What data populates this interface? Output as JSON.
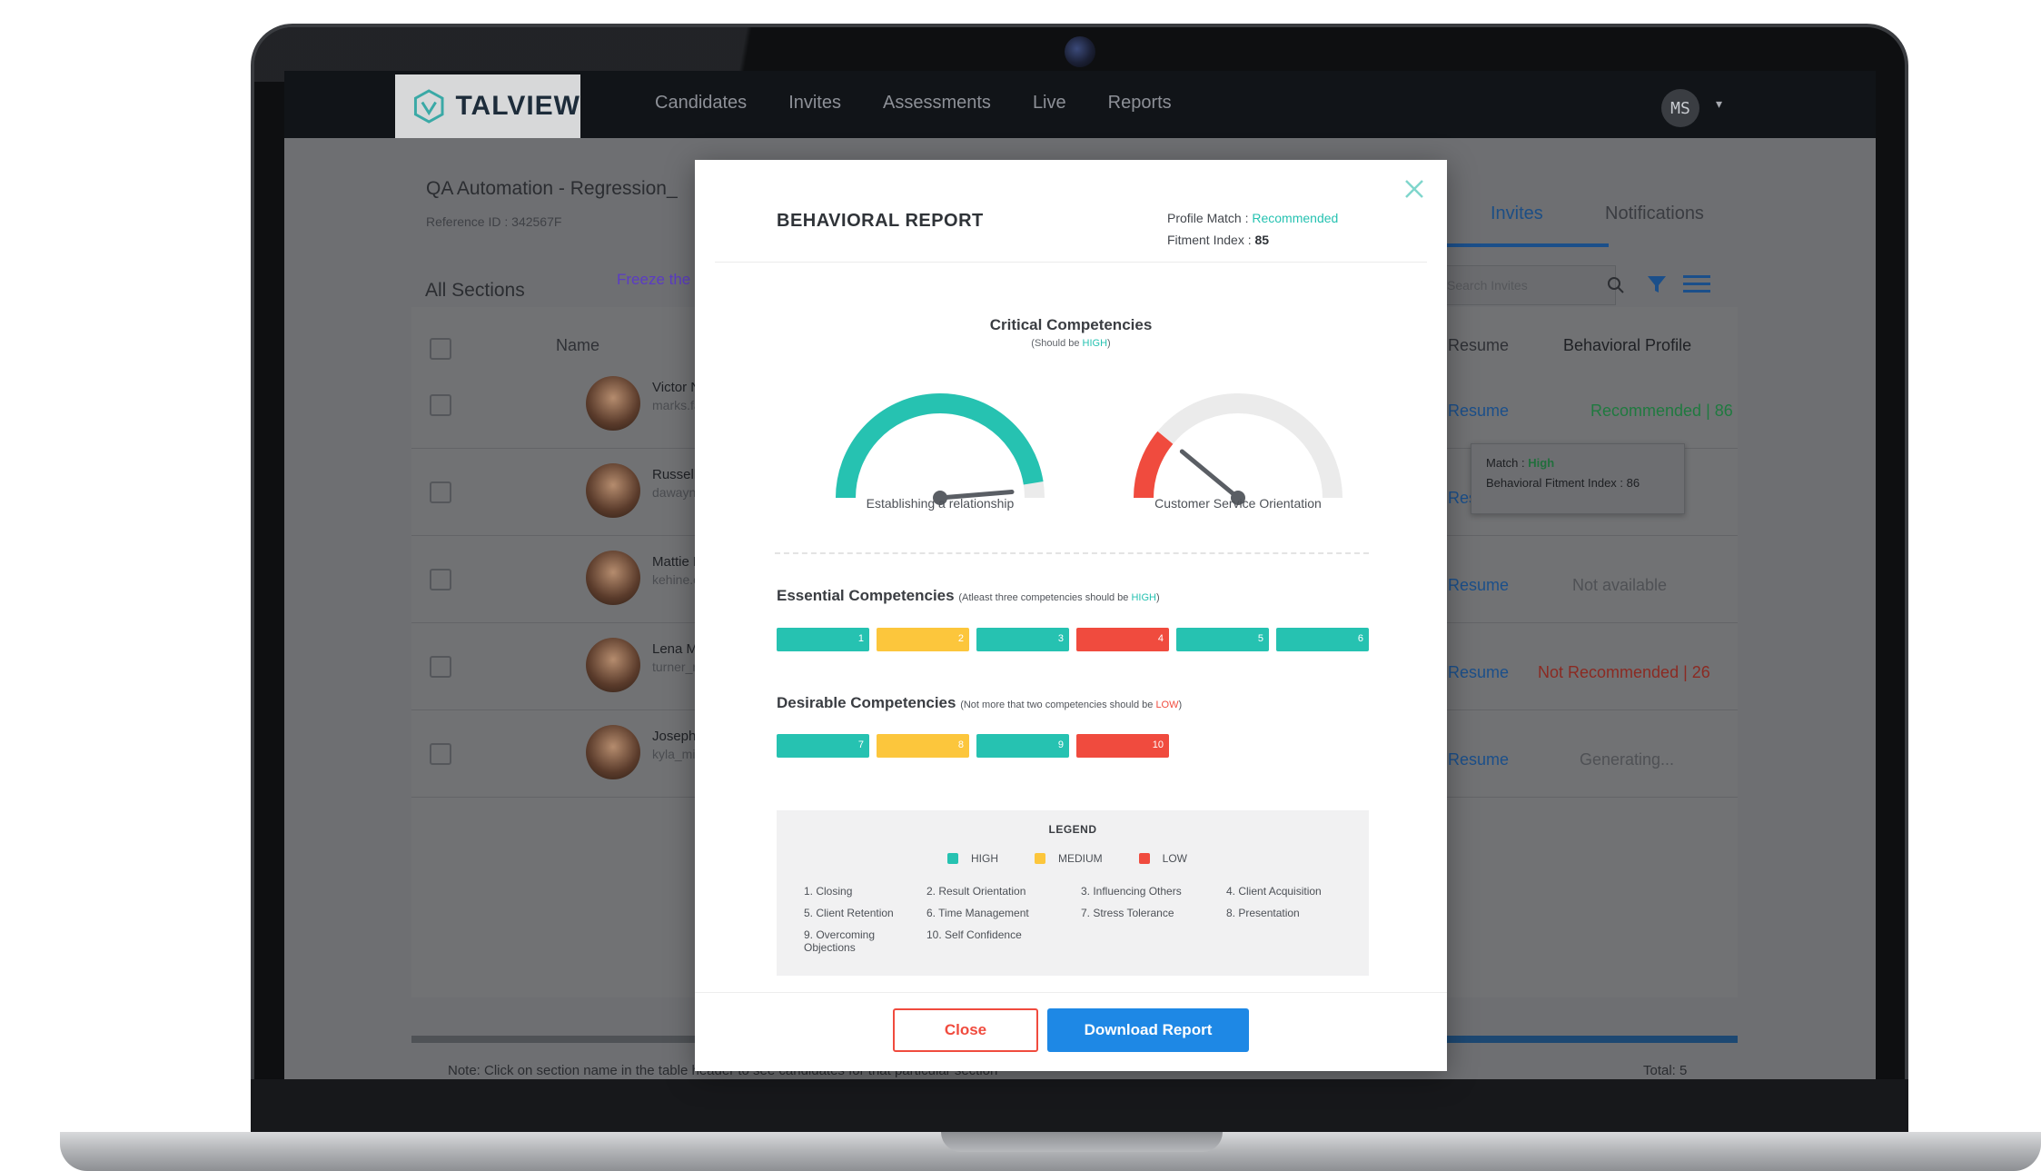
{
  "app": {
    "logo_text": "TALVIEW",
    "nav": [
      "Candidates",
      "Invites",
      "Assessments",
      "Live",
      "Reports"
    ],
    "user_initials": "MS",
    "caret": "▾"
  },
  "page": {
    "title": "QA Automation - Regression_",
    "reference": "Reference ID : 342567F",
    "all_sections": "All Sections",
    "freeze": "Freeze the",
    "tabs": [
      "Invites",
      "Notifications"
    ],
    "search_placeholder": "Search Invites",
    "columns": {
      "name": "Name",
      "resume": "Resume",
      "behavioral": "Behavioral Profile"
    },
    "rows": [
      {
        "name": "Victor Neal",
        "email": "marks.farna@davis.co",
        "resume": "Resume",
        "behavioral": "Recommended | 86"
      },
      {
        "name": "Russell Medina",
        "email": "dawayn_lorene@walt",
        "resume": "Resume",
        "behavioral": ""
      },
      {
        "name": "Mattie Porter",
        "email": "kehine.correll@hose",
        "resume": "Resume",
        "behavioral": "Not available"
      },
      {
        "name": "Lena Maxwell",
        "email": "turner_rollerick@gma",
        "resume": "Resume",
        "behavioral": "Not Recommended | 26"
      },
      {
        "name": "Joseph Hansen",
        "email": "kyla_mirrow@yahoo.c",
        "resume": "Resume",
        "behavioral": "Generating..."
      }
    ],
    "tooltip": {
      "match_label": "Match : ",
      "match_value": "High",
      "index": "Behavioral Fitment Index : 86"
    },
    "footer_note": "Note: Click on section name in the table header to see candidates for that particular section",
    "footer_total": "Total: 5"
  },
  "modal": {
    "title": "BEHAVIORAL REPORT",
    "profile_match_label": "Profile Match : ",
    "profile_match_value": "Recommended",
    "fitment_label": "Fitment Index : ",
    "fitment_value": "85",
    "critical": {
      "title": "Critical Competencies",
      "sub_prefix": "(Should be ",
      "sub_hl": "HIGH",
      "sub_suffix": ")",
      "gauges": [
        {
          "label": "Establishing a relationship",
          "level": 0.95,
          "color": "#26c2b1"
        },
        {
          "label": "Customer Service Orientation",
          "level": 0.22,
          "color": "#f04b3e"
        }
      ]
    },
    "essential": {
      "title": "Essential Competencies",
      "note_prefix": "(Atleast three competencies should be ",
      "note_hl": "HIGH",
      "note_suffix": ")",
      "bars": [
        {
          "n": "1",
          "level": "high"
        },
        {
          "n": "2",
          "level": "medium"
        },
        {
          "n": "3",
          "level": "high"
        },
        {
          "n": "4",
          "level": "low"
        },
        {
          "n": "5",
          "level": "high"
        },
        {
          "n": "6",
          "level": "high"
        }
      ]
    },
    "desirable": {
      "title": "Desirable Competencies",
      "note_prefix": "(Not more that two competencies should be ",
      "note_hl": "LOW",
      "note_suffix": ")",
      "bars": [
        {
          "n": "7",
          "level": "high"
        },
        {
          "n": "8",
          "level": "medium"
        },
        {
          "n": "9",
          "level": "high"
        },
        {
          "n": "10",
          "level": "low"
        }
      ]
    },
    "legend": {
      "title": "LEGEND",
      "keys": [
        {
          "label": "HIGH",
          "color": "#26c2b1"
        },
        {
          "label": "MEDIUM",
          "color": "#fcc63c"
        },
        {
          "label": "LOW",
          "color": "#f04b3e"
        }
      ],
      "items": [
        "1. Closing",
        "2. Result Orientation",
        "3. Influencing Others",
        "4. Client Acquisition",
        "5. Client Retention",
        "6. Time Management",
        "7. Stress Tolerance",
        "8. Presentation",
        "9. Overcoming Objections",
        "10. Self Confidence"
      ]
    },
    "buttons": {
      "close": "Close",
      "download": "Download Report"
    }
  },
  "colors": {
    "high": "#26c2b1",
    "medium": "#fcc63c",
    "low": "#f04b3e",
    "primary": "#1e88e5"
  }
}
